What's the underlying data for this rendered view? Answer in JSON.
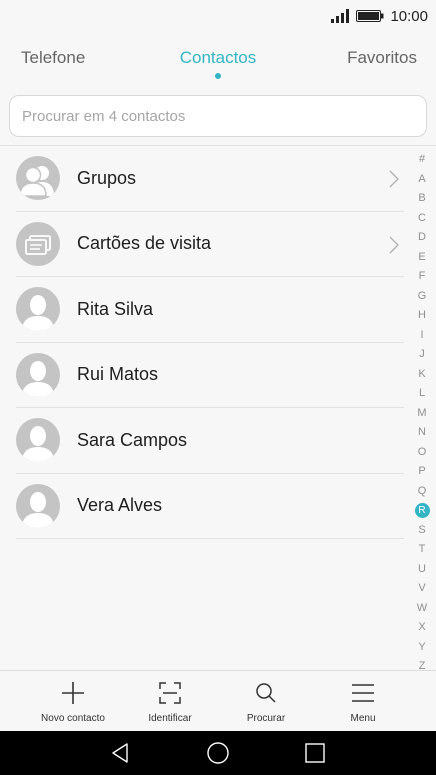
{
  "status_bar": {
    "time": "10:00",
    "signal_icon": "signal-bars-icon",
    "battery_icon": "battery-icon"
  },
  "tabs": [
    {
      "label": "Telefone",
      "active": false
    },
    {
      "label": "Contactos",
      "active": true
    },
    {
      "label": "Favoritos",
      "active": false
    }
  ],
  "search": {
    "placeholder": "Procurar em 4 contactos",
    "value": ""
  },
  "list": [
    {
      "label": "Grupos",
      "icon": "groups-icon",
      "chevron": true
    },
    {
      "label": "Cartões de visita",
      "icon": "business-cards-icon",
      "chevron": true
    },
    {
      "label": "Rita Silva",
      "icon": "person-icon",
      "chevron": false
    },
    {
      "label": "Rui Matos",
      "icon": "person-icon",
      "chevron": false
    },
    {
      "label": "Sara Campos",
      "icon": "person-icon",
      "chevron": false
    },
    {
      "label": "Vera Alves",
      "icon": "person-icon",
      "chevron": false
    }
  ],
  "alphabet_index": [
    "#",
    "A",
    "B",
    "C",
    "D",
    "E",
    "F",
    "G",
    "H",
    "I",
    "J",
    "K",
    "L",
    "M",
    "N",
    "O",
    "P",
    "Q",
    "R",
    "S",
    "T",
    "U",
    "V",
    "W",
    "X",
    "Y",
    "Z"
  ],
  "alphabet_active": "R",
  "toolbar": {
    "new_contact": "Novo contacto",
    "identify": "Identificar",
    "search": "Procurar",
    "menu": "Menu"
  },
  "colors": {
    "accent": "#33b5c5",
    "background": "#f7f7f7",
    "avatar": "#c4c4c4",
    "nav_bar": "#000000"
  }
}
